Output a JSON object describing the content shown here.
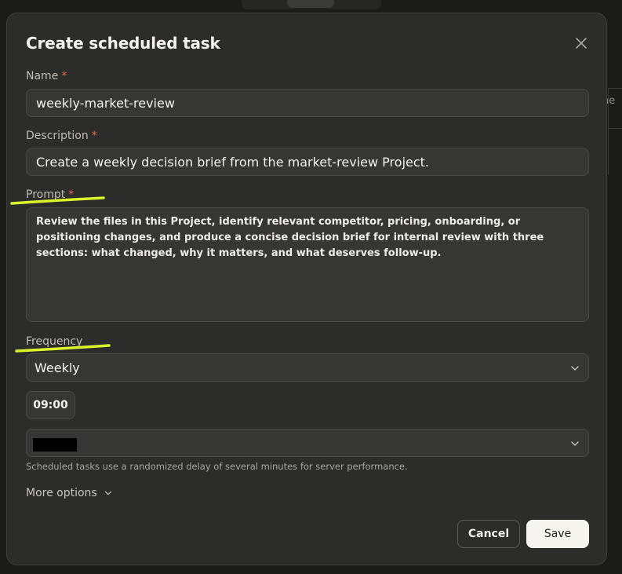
{
  "dialog": {
    "title": "Create scheduled task",
    "close_icon": "close-icon"
  },
  "name": {
    "label": "Name",
    "required": "*",
    "value": "weekly-market-review"
  },
  "description": {
    "label": "Description",
    "required": "*",
    "value": "Create a weekly decision brief from the market-review Project."
  },
  "prompt": {
    "label": "Prompt",
    "required": "*",
    "value": "Review the files in this Project, identify relevant competitor, pricing, onboarding, or positioning changes, and produce a concise decision brief for internal review with three sections: what changed, why it matters, and what deserves follow-up."
  },
  "frequency": {
    "label": "Frequency",
    "value": "Weekly"
  },
  "time": {
    "value": "09:00"
  },
  "timezone": {
    "value": ""
  },
  "hint": "Scheduled tasks use a randomized delay of several minutes for server performance.",
  "more_options": "More options",
  "buttons": {
    "cancel": "Cancel",
    "save": "Save"
  },
  "background": {
    "panel_text": "he"
  },
  "colors": {
    "required": "#e06a4b",
    "highlight": "#d9f52b",
    "save_bg": "#f6f4ef"
  }
}
